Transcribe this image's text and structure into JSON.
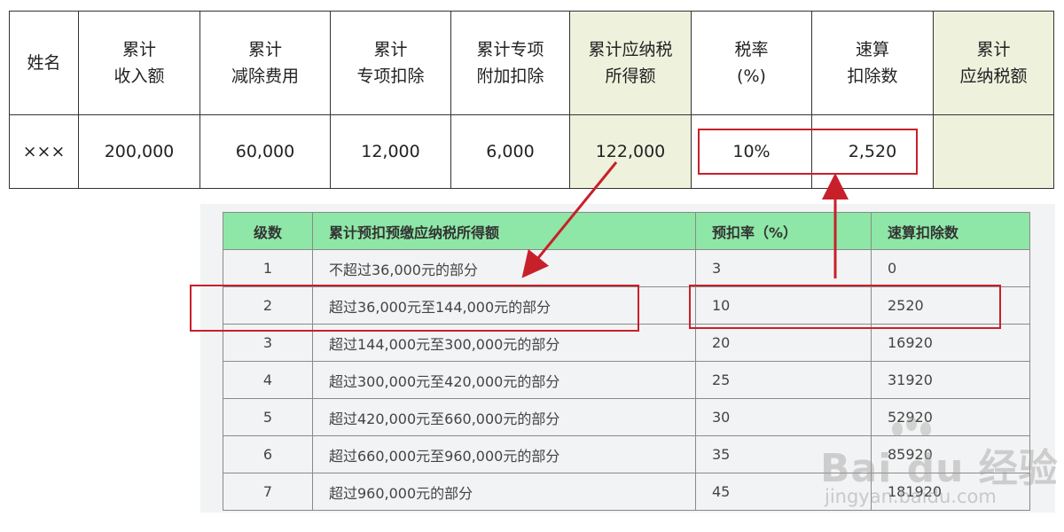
{
  "calc_table": {
    "headers": [
      [
        "姓名"
      ],
      [
        "累计",
        "收入额"
      ],
      [
        "累计",
        "减除费用"
      ],
      [
        "累计",
        "专项扣除"
      ],
      [
        "累计专项",
        "附加扣除"
      ],
      [
        "累计应纳税",
        "所得额"
      ],
      [
        "税率",
        "(%)"
      ],
      [
        "速算",
        "扣除数"
      ],
      [
        "累计",
        "应纳税额"
      ]
    ],
    "row": [
      "×××",
      "200,000",
      "60,000",
      "12,000",
      "6,000",
      "122,000",
      "10%",
      "2,520",
      ""
    ],
    "highlight_color": "#eef1dc"
  },
  "bracket_table": {
    "headers": [
      "级数",
      "累计预扣预缴应纳税所得额",
      "预扣率（%）",
      "速算扣除数"
    ],
    "rows": [
      [
        "1",
        "不超过36,000元的部分",
        "3",
        "0"
      ],
      [
        "2",
        "超过36,000元至144,000元的部分",
        "10",
        "2520"
      ],
      [
        "3",
        "超过144,000元至300,000元的部分",
        "20",
        "16920"
      ],
      [
        "4",
        "超过300,000元至420,000元的部分",
        "25",
        "31920"
      ],
      [
        "5",
        "超过420,000元至660,000元的部分",
        "30",
        "52920"
      ],
      [
        "6",
        "超过660,000元至960,000元的部分",
        "35",
        "85920"
      ],
      [
        "7",
        "超过960,000元的部分",
        "45",
        "181920"
      ]
    ],
    "header_color": "#8ee7a6",
    "highlighted_row": 2
  },
  "annotation_color": "#c8202a",
  "watermark": {
    "logo": "Bai du 经验",
    "url": "jingyan.baidu.com"
  }
}
